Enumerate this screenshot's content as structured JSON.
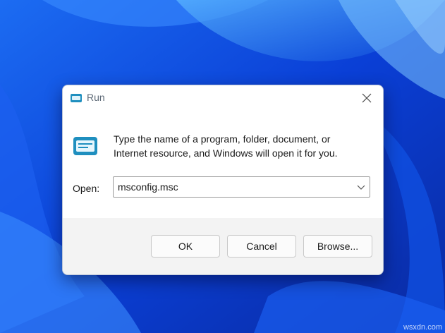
{
  "dialog": {
    "title": "Run",
    "description_line1": "Type the name of a program, folder, document, or",
    "description_line2": "Internet resource, and Windows will open it for you.",
    "open_label": "Open:",
    "open_value": "msconfig.msc",
    "buttons": {
      "ok": "OK",
      "cancel": "Cancel",
      "browse": "Browse..."
    }
  },
  "icons": {
    "title": "run-icon",
    "main": "run-icon",
    "close": "close-icon",
    "dropdown": "chevron-down-icon"
  },
  "colors": {
    "wallpaper_blue": "#0a3fd6",
    "icon_teal": "#1f8fbf"
  },
  "watermark": "wsxdn.com"
}
